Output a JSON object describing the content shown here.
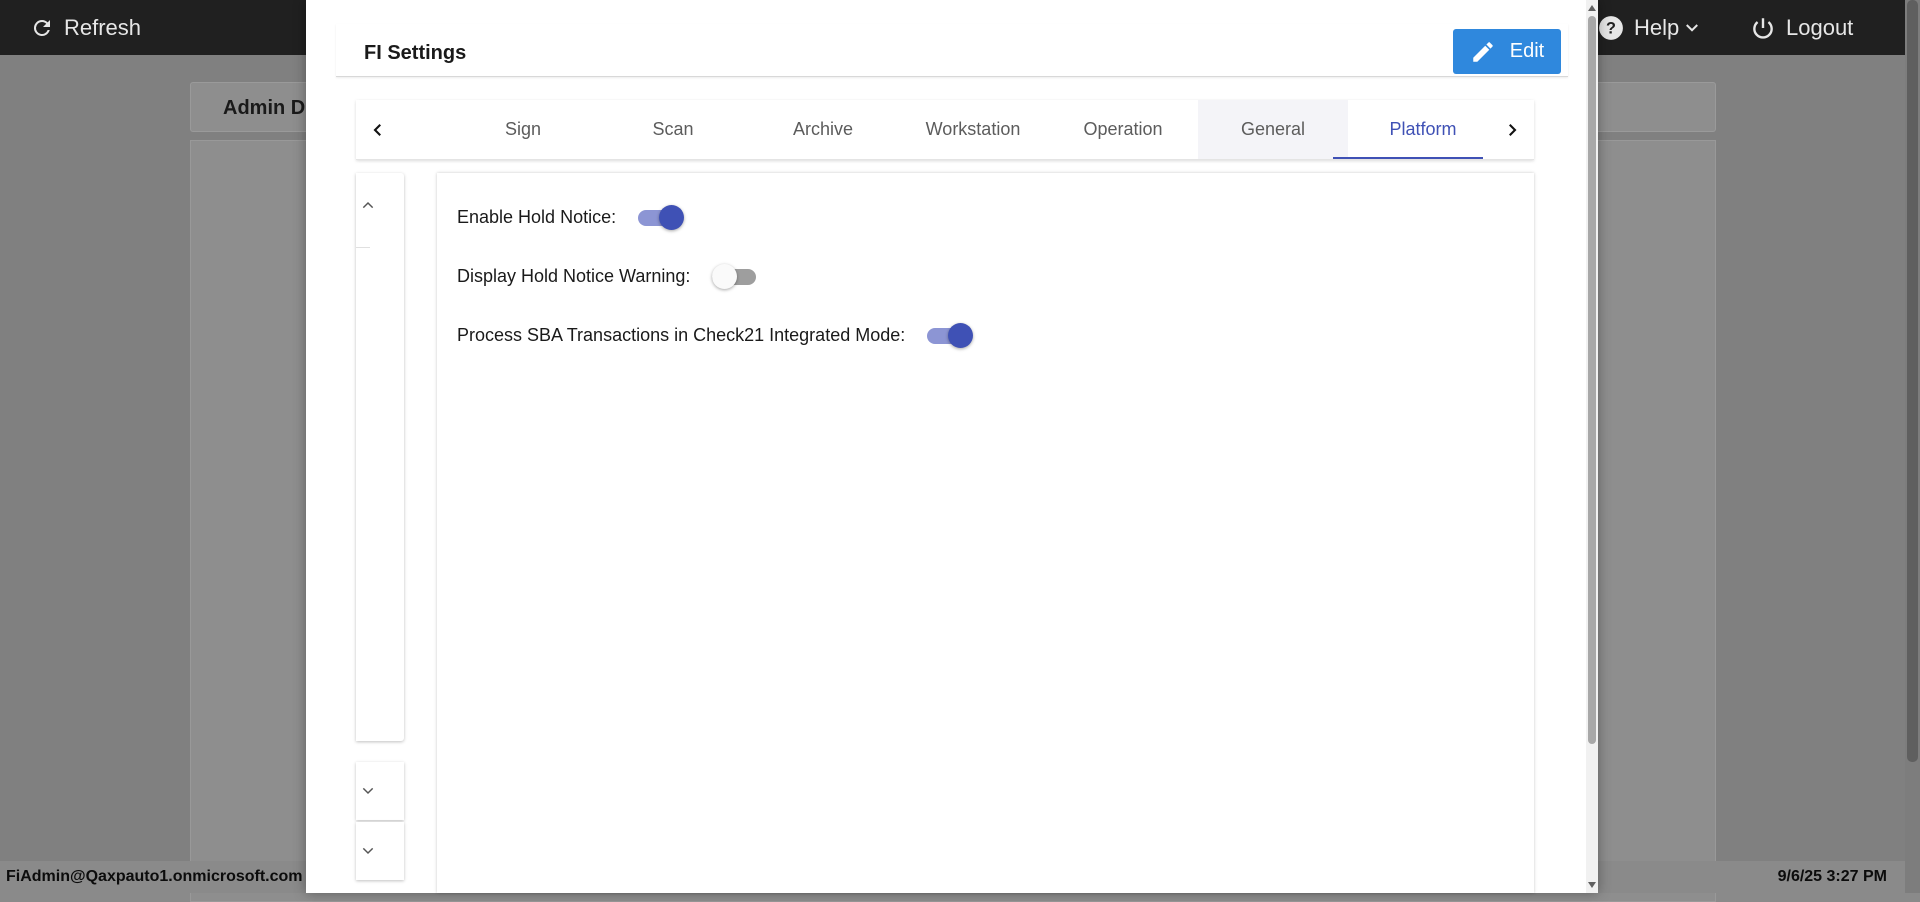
{
  "topbar": {
    "refresh_label": "Refresh",
    "help_label": "Help",
    "logout_label": "Logout"
  },
  "background": {
    "header_title": "Admin D"
  },
  "footer": {
    "user": "FiAdmin@Qaxpauto1.onmicrosoft.com",
    "datetime": "9/6/25 3:27 PM"
  },
  "modal": {
    "title": "FI Settings",
    "edit_label": "Edit",
    "tabs": [
      {
        "label": "Sign"
      },
      {
        "label": "Scan"
      },
      {
        "label": "Archive"
      },
      {
        "label": "Workstation"
      },
      {
        "label": "Operation"
      },
      {
        "label": "General"
      },
      {
        "label": "Platform"
      }
    ],
    "active_tab": "Platform",
    "settings": [
      {
        "label": "Enable Hold Notice:",
        "enabled": true
      },
      {
        "label": "Display Hold Notice Warning:",
        "enabled": false
      },
      {
        "label": "Process SBA Transactions in Check21 Integrated Mode:",
        "enabled": true
      }
    ]
  },
  "colors": {
    "accent": "#3f51b5",
    "edit_button": "#2f88dd",
    "topbar": "#202020"
  },
  "icons": {
    "refresh": "refresh-icon",
    "help": "help-circle-icon",
    "logout": "power-icon",
    "edit": "pencil-icon"
  }
}
